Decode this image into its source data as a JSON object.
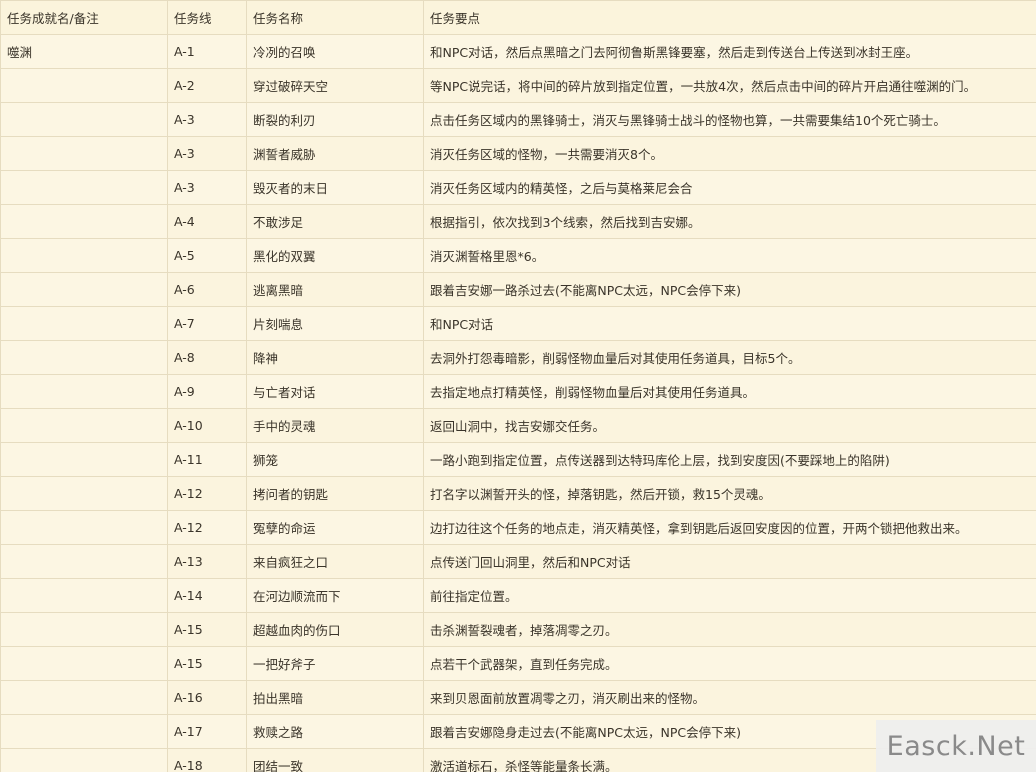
{
  "table": {
    "headers": [
      "任务成就名/备注",
      "任务线",
      "任务名称",
      "任务要点"
    ],
    "rows": [
      {
        "achievement": "噬渊",
        "line": "A-1",
        "name": "冷冽的召唤",
        "point": "和NPC对话，然后点黑暗之门去阿彻鲁斯黑锋要塞，然后走到传送台上传送到冰封王座。"
      },
      {
        "achievement": "",
        "line": "A-2",
        "name": "穿过破碎天空",
        "point": "等NPC说完话，将中间的碎片放到指定位置，一共放4次，然后点击中间的碎片开启通往噬渊的门。"
      },
      {
        "achievement": "",
        "line": "A-3",
        "name": "断裂的利刃",
        "point": "点击任务区域内的黑锋骑士，消灭与黑锋骑士战斗的怪物也算，一共需要集结10个死亡骑士。"
      },
      {
        "achievement": "",
        "line": "A-3",
        "name": "渊誓者威胁",
        "point": "消灭任务区域的怪物，一共需要消灭8个。"
      },
      {
        "achievement": "",
        "line": "A-3",
        "name": "毁灭者的末日",
        "point": "消灭任务区域内的精英怪，之后与莫格莱尼会合"
      },
      {
        "achievement": "",
        "line": "A-4",
        "name": "不敢涉足",
        "point": "根据指引，依次找到3个线索，然后找到吉安娜。"
      },
      {
        "achievement": "",
        "line": "A-5",
        "name": "黑化的双翼",
        "point": "消灭渊誓格里恩*6。"
      },
      {
        "achievement": "",
        "line": "A-6",
        "name": "逃离黑暗",
        "point": "跟着吉安娜一路杀过去(不能离NPC太远，NPC会停下来)"
      },
      {
        "achievement": "",
        "line": "A-7",
        "name": "片刻喘息",
        "point": "和NPC对话"
      },
      {
        "achievement": "",
        "line": "A-8",
        "name": "降神",
        "point": "去洞外打怨毒暗影，削弱怪物血量后对其使用任务道具，目标5个。"
      },
      {
        "achievement": "",
        "line": "A-9",
        "name": "与亡者对话",
        "point": "去指定地点打精英怪，削弱怪物血量后对其使用任务道具。"
      },
      {
        "achievement": "",
        "line": "A-10",
        "name": "手中的灵魂",
        "point": "返回山洞中，找吉安娜交任务。"
      },
      {
        "achievement": "",
        "line": "A-11",
        "name": "狮笼",
        "point": "一路小跑到指定位置，点传送器到达特玛库伦上层，找到安度因(不要踩地上的陷阱)"
      },
      {
        "achievement": "",
        "line": "A-12",
        "name": "拷问者的钥匙",
        "point": "打名字以渊誓开头的怪，掉落钥匙，然后开锁，救15个灵魂。"
      },
      {
        "achievement": "",
        "line": "A-12",
        "name": "冤孽的命运",
        "point": "边打边往这个任务的地点走，消灭精英怪，拿到钥匙后返回安度因的位置，开两个锁把他救出来。"
      },
      {
        "achievement": "",
        "line": "A-13",
        "name": "来自疯狂之口",
        "point": "点传送门回山洞里，然后和NPC对话"
      },
      {
        "achievement": "",
        "line": "A-14",
        "name": "在河边顺流而下",
        "point": "前往指定位置。"
      },
      {
        "achievement": "",
        "line": "A-15",
        "name": "超越血肉的伤口",
        "point": "击杀渊誓裂魂者，掉落凋零之刃。"
      },
      {
        "achievement": "",
        "line": "A-15",
        "name": "一把好斧子",
        "point": "点若干个武器架，直到任务完成。"
      },
      {
        "achievement": "",
        "line": "A-16",
        "name": "拍出黑暗",
        "point": "来到贝恩面前放置凋零之刃，消灭刷出来的怪物。"
      },
      {
        "achievement": "",
        "line": "A-17",
        "name": "救赎之路",
        "point": "跟着吉安娜隐身走过去(不能离NPC太远，NPC会停下来)"
      },
      {
        "achievement": "",
        "line": "A-18",
        "name": "团结一致",
        "point": "激活道标石，杀怪等能量条长满。"
      }
    ]
  },
  "watermark": "Easck.Net"
}
